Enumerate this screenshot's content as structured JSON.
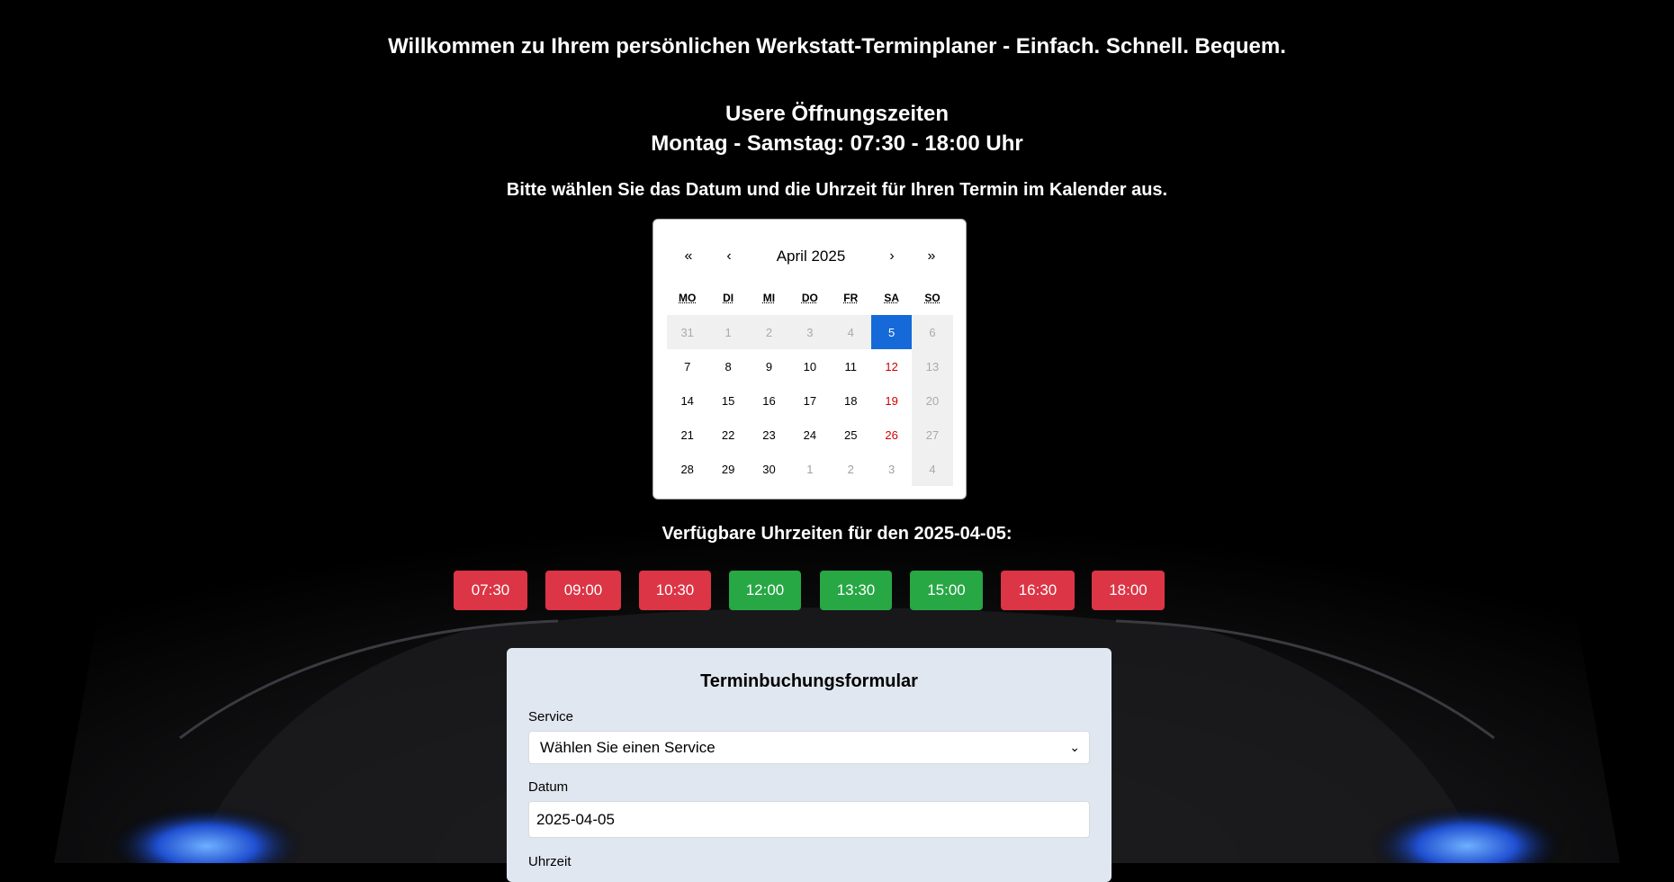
{
  "welcome": "Willkommen zu Ihrem persönlichen Werkstatt-Terminplaner - Einfach. Schnell. Bequem.",
  "hours": {
    "title": "Usere Öffnungszeiten",
    "times": "Montag - Samstag: 07:30 - 18:00 Uhr"
  },
  "instruction": "Bitte wählen Sie das Datum und die Uhrzeit für Ihren Termin im Kalender aus.",
  "calendar": {
    "nav_first": "«",
    "nav_prev": "‹",
    "title": "April 2025",
    "nav_next": "›",
    "nav_last": "»",
    "weekdays": [
      "MO",
      "DI",
      "MI",
      "DO",
      "FR",
      "SA",
      "SO"
    ],
    "days": [
      {
        "label": "31",
        "state": "disabled"
      },
      {
        "label": "1",
        "state": "disabled"
      },
      {
        "label": "2",
        "state": "disabled"
      },
      {
        "label": "3",
        "state": "disabled"
      },
      {
        "label": "4",
        "state": "disabled"
      },
      {
        "label": "5",
        "state": "selected"
      },
      {
        "label": "6",
        "state": "disabled"
      },
      {
        "label": "7",
        "state": "normal"
      },
      {
        "label": "8",
        "state": "normal"
      },
      {
        "label": "9",
        "state": "normal"
      },
      {
        "label": "10",
        "state": "normal"
      },
      {
        "label": "11",
        "state": "normal"
      },
      {
        "label": "12",
        "state": "weekend"
      },
      {
        "label": "13",
        "state": "disabled"
      },
      {
        "label": "14",
        "state": "normal"
      },
      {
        "label": "15",
        "state": "normal"
      },
      {
        "label": "16",
        "state": "normal"
      },
      {
        "label": "17",
        "state": "normal"
      },
      {
        "label": "18",
        "state": "normal"
      },
      {
        "label": "19",
        "state": "weekend"
      },
      {
        "label": "20",
        "state": "disabled"
      },
      {
        "label": "21",
        "state": "normal"
      },
      {
        "label": "22",
        "state": "normal"
      },
      {
        "label": "23",
        "state": "normal"
      },
      {
        "label": "24",
        "state": "normal"
      },
      {
        "label": "25",
        "state": "normal"
      },
      {
        "label": "26",
        "state": "weekend"
      },
      {
        "label": "27",
        "state": "disabled"
      },
      {
        "label": "28",
        "state": "normal"
      },
      {
        "label": "29",
        "state": "normal"
      },
      {
        "label": "30",
        "state": "normal"
      },
      {
        "label": "1",
        "state": "dim"
      },
      {
        "label": "2",
        "state": "dim"
      },
      {
        "label": "3",
        "state": "dim"
      },
      {
        "label": "4",
        "state": "disabled"
      }
    ],
    "colors": {
      "selected": "#1669d9",
      "weekend": "#d10000"
    }
  },
  "slots": {
    "title": "Verfügbare Uhrzeiten für den 2025-04-05:",
    "items": [
      {
        "time": "07:30",
        "status": "booked"
      },
      {
        "time": "09:00",
        "status": "booked"
      },
      {
        "time": "10:30",
        "status": "booked"
      },
      {
        "time": "12:00",
        "status": "available"
      },
      {
        "time": "13:30",
        "status": "available"
      },
      {
        "time": "15:00",
        "status": "available"
      },
      {
        "time": "16:30",
        "status": "booked"
      },
      {
        "time": "18:00",
        "status": "booked"
      }
    ],
    "colors": {
      "booked": "#dc3545",
      "available": "#28a745"
    }
  },
  "form": {
    "title": "Terminbuchungsformular",
    "service_label": "Service",
    "service_value": "Wählen Sie einen Service",
    "date_label": "Datum",
    "date_value": "2025-04-05",
    "time_label": "Uhrzeit"
  }
}
